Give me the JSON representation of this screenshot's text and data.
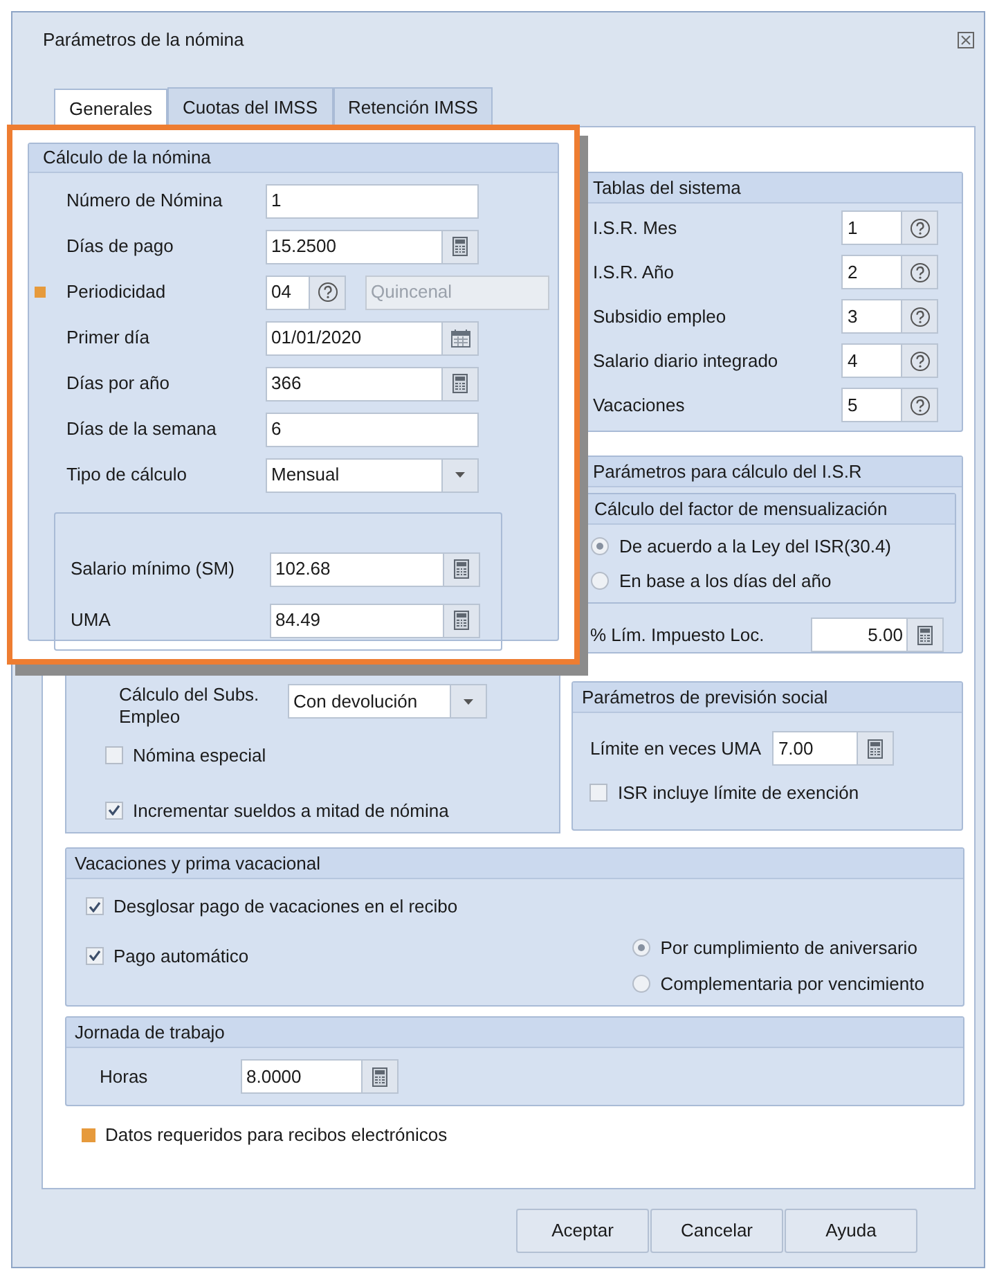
{
  "window": {
    "title": "Parámetros de la nómina"
  },
  "tabs": [
    {
      "label": "Generales",
      "selected": true
    },
    {
      "label": "Cuotas del IMSS",
      "selected": false
    },
    {
      "label": "Retención IMSS",
      "selected": false
    }
  ],
  "payroll_calc": {
    "title": "Cálculo de la nómina",
    "fields": [
      {
        "kind": "text",
        "label": "Número de Nómina",
        "value": "1",
        "required": false
      },
      {
        "kind": "calc",
        "label": "Días de pago",
        "value": "15.2500",
        "required": false
      },
      {
        "kind": "lookup",
        "label": "Periodicidad",
        "value": "04",
        "description": "Quincenal",
        "required": true
      },
      {
        "kind": "date",
        "label": "Primer día",
        "value": "01/01/2020",
        "required": false
      },
      {
        "kind": "calc",
        "label": "Días por año",
        "value": "366",
        "required": false
      },
      {
        "kind": "text",
        "label": "Días de la semana",
        "value": "6",
        "required": false
      },
      {
        "kind": "combo",
        "label": "Tipo de cálculo",
        "value": "Mensual",
        "required": false
      }
    ],
    "wage_fields": [
      {
        "label": "Salario mínimo (SM)",
        "value": "102.68"
      },
      {
        "label": "UMA",
        "value": "84.49"
      }
    ]
  },
  "subsidy": {
    "label": "Cálculo del Subs. Empleo",
    "value": "Con devolución"
  },
  "options": [
    {
      "label": "Nómina especial",
      "checked": false
    },
    {
      "label": "Incrementar sueldos a mitad de nómina",
      "checked": true
    }
  ],
  "system_tables": {
    "title": "Tablas del sistema",
    "rows": [
      {
        "label": "I.S.R. Mes",
        "value": "1"
      },
      {
        "label": "I.S.R. Año",
        "value": "2"
      },
      {
        "label": "Subsidio empleo",
        "value": "3"
      },
      {
        "label": "Salario diario integrado",
        "value": "4"
      },
      {
        "label": "Vacaciones",
        "value": "5"
      }
    ]
  },
  "isr": {
    "title": "Parámetros para cálculo del I.S.R",
    "subgroup": "Cálculo del factor de mensualización",
    "options": [
      {
        "label": "De acuerdo a la Ley del ISR(30.4)",
        "selected": true
      },
      {
        "label": "En base a los días del año",
        "selected": false
      }
    ],
    "limit_label": "% Lím. Impuesto Loc.",
    "limit_value": "5.00"
  },
  "social": {
    "title": "Parámetros de previsión social",
    "limit_label": "Límite en veces UMA",
    "limit_value": "7.00",
    "check": {
      "label": "ISR incluye límite de exención",
      "checked": false
    }
  },
  "vacation": {
    "title": "Vacaciones y prima vacacional",
    "checks": [
      {
        "label": "Desglosar pago de vacaciones en el recibo",
        "checked": true
      },
      {
        "label": "Pago automático",
        "checked": true
      }
    ],
    "options": [
      {
        "label": "Por cumplimiento de aniversario",
        "selected": true
      },
      {
        "label": "Complementaria por vencimiento",
        "selected": false
      }
    ]
  },
  "workday": {
    "title": "Jornada de trabajo",
    "label": "Horas",
    "value": "8.0000"
  },
  "legend": "Datos requeridos para recibos electrónicos",
  "buttons": [
    "Aceptar",
    "Cancelar",
    "Ayuda"
  ]
}
